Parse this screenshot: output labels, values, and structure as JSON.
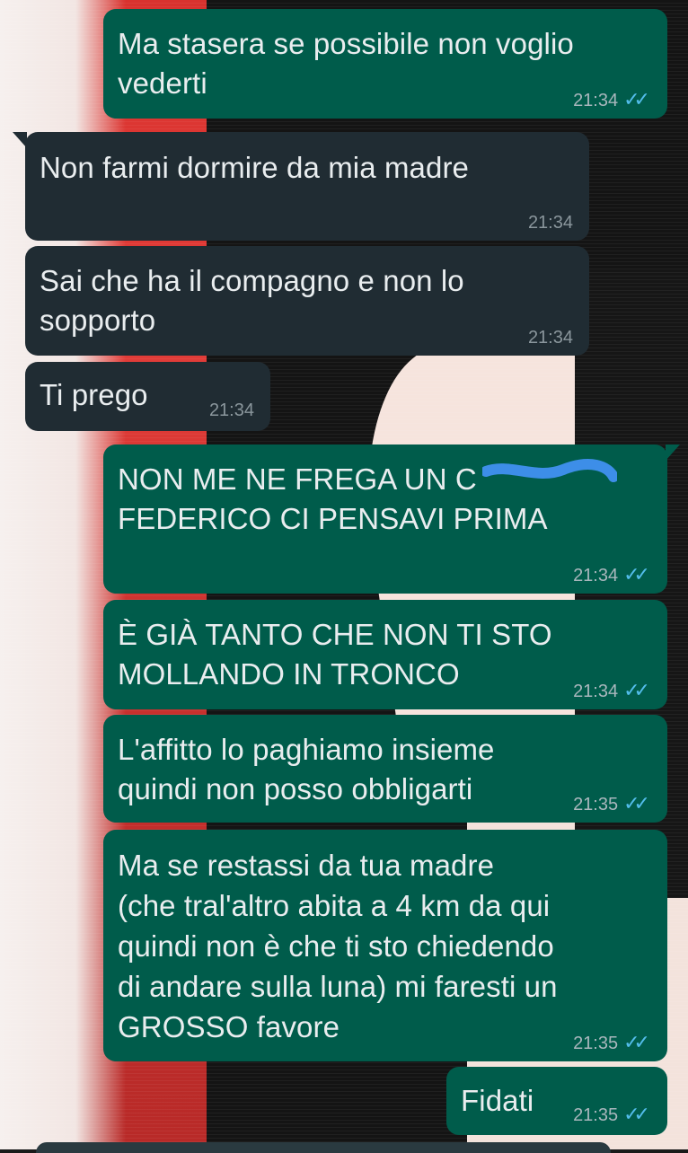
{
  "colors": {
    "outgoing_bubble": "#005c4b",
    "incoming_bubble": "#202c33",
    "message_text": "#e9edef",
    "read_ticks": "#53bdeb"
  },
  "messages": [
    {
      "direction": "outgoing",
      "text": "Ma stasera se possibile non voglio\nvederti",
      "time": "21:34",
      "status": "read-double-check-icon"
    },
    {
      "direction": "incoming",
      "text": "Non farmi dormire da mia madre",
      "time": "21:34"
    },
    {
      "direction": "incoming",
      "text": "Sai che ha il compagno e non lo\nsopporto",
      "time": "21:34"
    },
    {
      "direction": "incoming",
      "text": "Ti prego",
      "time": "21:34"
    },
    {
      "direction": "outgoing",
      "text": "NON ME NE FREGA UN C\nFEDERICO CI PENSAVI PRIMA",
      "time": "21:34",
      "status": "read-double-check-icon"
    },
    {
      "direction": "outgoing",
      "text": "È GIÀ TANTO CHE NON TI STO\nMOLLANDO IN TRONCO",
      "time": "21:34",
      "status": "read-double-check-icon"
    },
    {
      "direction": "outgoing",
      "text": "L'affitto lo paghiamo insieme\nquindi non posso obbligarti",
      "time": "21:35",
      "status": "read-double-check-icon"
    },
    {
      "direction": "outgoing",
      "text": "Ma se restassi da tua madre\n(che tral'altro abita a 4 km da qui\nquindi non è che ti sto chiedendo\ndi andare sulla luna) mi faresti un\nGROSSO favore",
      "time": "21:35",
      "status": "read-double-check-icon"
    },
    {
      "direction": "outgoing",
      "text": "Fidati",
      "time": "21:35",
      "status": "read-double-check-icon"
    }
  ]
}
